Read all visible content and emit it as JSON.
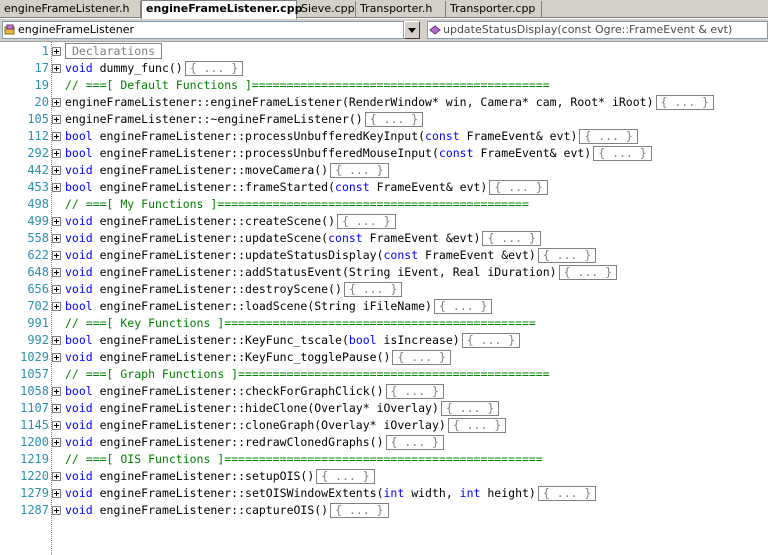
{
  "tabs": [
    {
      "label": "engineFrameListener.h",
      "active": false
    },
    {
      "label": "engineFrameListener.cpp",
      "active": true
    },
    {
      "label": "Sieve.cpp",
      "active": false
    },
    {
      "label": "Transporter.h",
      "active": false
    },
    {
      "label": "Transporter.cpp",
      "active": false
    }
  ],
  "navbar": {
    "class_combo_value": "engineFrameListener",
    "member_combo_value": "updateStatusDisplay(const Ogre::FrameEvent & evt)"
  },
  "colors": {
    "keyword": "#0000ff",
    "comment": "#008000",
    "line_number": "#2b91af"
  },
  "editor": {
    "collapsed_marker": "{ ... }",
    "lines": [
      {
        "num": "1",
        "kind": "decl",
        "text": "Declarations"
      },
      {
        "num": "17",
        "kind": "code",
        "kw": "void",
        "text": " dummy_func()",
        "collapsed": true
      },
      {
        "num": "19",
        "kind": "comment",
        "text": "// ===[ Default Functions ]==========================================="
      },
      {
        "num": "20",
        "kind": "code",
        "kw": "",
        "text": "engineFrameListener::engineFrameListener(RenderWindow* win, Camera* cam, Root* iRoot)",
        "collapsed": true
      },
      {
        "num": "105",
        "kind": "code",
        "kw": "",
        "text": "engineFrameListener::~engineFrameListener()",
        "collapsed": true
      },
      {
        "num": "112",
        "kind": "code",
        "kw": "bool",
        "text": " engineFrameListener::processUnbufferedKeyInput(",
        "kw2": "const",
        "text2": " FrameEvent& evt)",
        "collapsed": true
      },
      {
        "num": "292",
        "kind": "code",
        "kw": "bool",
        "text": " engineFrameListener::processUnbufferedMouseInput(",
        "kw2": "const",
        "text2": " FrameEvent& evt)",
        "collapsed": true
      },
      {
        "num": "442",
        "kind": "code",
        "kw": "void",
        "text": " engineFrameListener::moveCamera()",
        "collapsed": true
      },
      {
        "num": "453",
        "kind": "code",
        "kw": "bool",
        "text": " engineFrameListener::frameStarted(",
        "kw2": "const",
        "text2": " FrameEvent& evt)",
        "collapsed": true
      },
      {
        "num": "498",
        "kind": "comment",
        "text": "// ===[ My Functions ]============================================="
      },
      {
        "num": "499",
        "kind": "code",
        "kw": "void",
        "text": " engineFrameListener::createScene()",
        "collapsed": true
      },
      {
        "num": "558",
        "kind": "code",
        "kw": "void",
        "text": " engineFrameListener::updateScene(",
        "kw2": "const",
        "text2": " FrameEvent &evt)",
        "collapsed": true
      },
      {
        "num": "622",
        "kind": "code",
        "kw": "void",
        "text": " engineFrameListener::updateStatusDisplay(",
        "kw2": "const",
        "text2": " FrameEvent &evt)",
        "collapsed": true
      },
      {
        "num": "648",
        "kind": "code",
        "kw": "void",
        "text": " engineFrameListener::addStatusEvent(String iEvent, Real iDuration)",
        "collapsed": true
      },
      {
        "num": "656",
        "kind": "code",
        "kw": "void",
        "text": " engineFrameListener::destroyScene()",
        "collapsed": true
      },
      {
        "num": "702",
        "kind": "code",
        "kw": "bool",
        "text": " engineFrameListener::loadScene(String iFileName)",
        "collapsed": true
      },
      {
        "num": "991",
        "kind": "comment",
        "text": "// ===[ Key Functions ]============================================="
      },
      {
        "num": "992",
        "kind": "code",
        "kw": "bool",
        "text": " engineFrameListener::KeyFunc_tscale(",
        "kw2": "bool",
        "text2": " isIncrease)",
        "collapsed": true
      },
      {
        "num": "1029",
        "kind": "code",
        "kw": "void",
        "text": " engineFrameListener::KeyFunc_togglePause()",
        "collapsed": true
      },
      {
        "num": "1057",
        "kind": "comment",
        "text": "// ===[ Graph Functions ]============================================="
      },
      {
        "num": "1058",
        "kind": "code",
        "kw": "bool",
        "text": " engineFrameListener::checkForGraphClick()",
        "collapsed": true
      },
      {
        "num": "1107",
        "kind": "code",
        "kw": "void",
        "text": " engineFrameListener::hideClone(Overlay* iOverlay)",
        "collapsed": true
      },
      {
        "num": "1145",
        "kind": "code",
        "kw": "void",
        "text": " engineFrameListener::cloneGraph(Overlay* iOverlay)",
        "collapsed": true
      },
      {
        "num": "1200",
        "kind": "code",
        "kw": "void",
        "text": " engineFrameListener::redrawClonedGraphs()",
        "collapsed": true
      },
      {
        "num": "1219",
        "kind": "comment",
        "text": "// ===[ OIS Functions ]=============================================="
      },
      {
        "num": "1220",
        "kind": "code",
        "kw": "void",
        "text": " engineFrameListener::setupOIS()",
        "collapsed": true
      },
      {
        "num": "1279",
        "kind": "code",
        "kw": "void",
        "text": " engineFrameListener::setOISWindowExtents(",
        "kw2": "int",
        "text2": " width, ",
        "kw3": "int",
        "text3": " height)",
        "collapsed": true
      },
      {
        "num": "1287",
        "kind": "code",
        "kw": "void",
        "text": " engineFrameListener::captureOIS()",
        "collapsed": true
      }
    ]
  }
}
